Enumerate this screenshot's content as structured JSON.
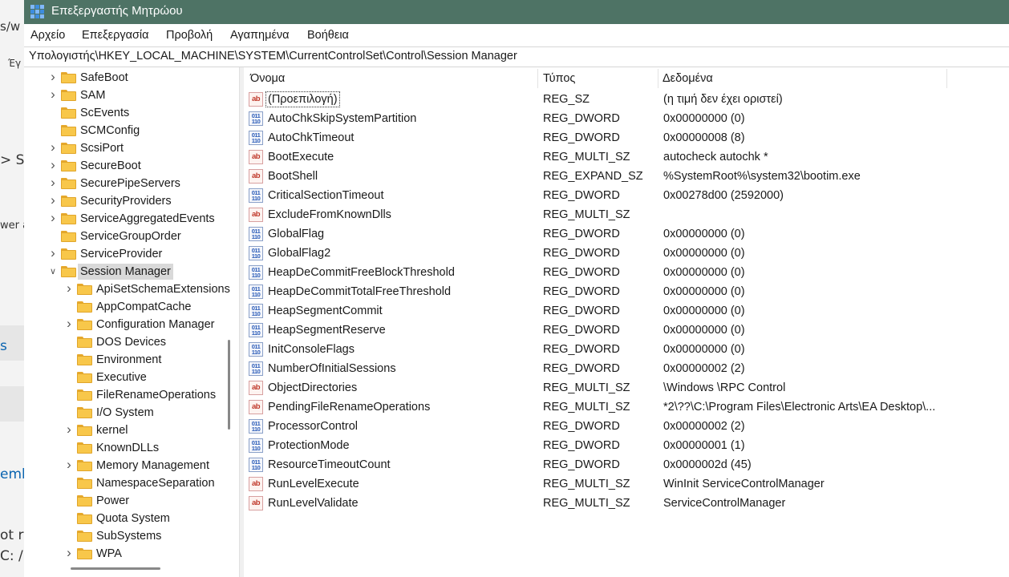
{
  "background_window": {
    "fragments": [
      "s/w",
      "Έγ",
      "> SY",
      "wer a",
      "s",
      "emb",
      "ot r",
      "C: /r"
    ]
  },
  "window": {
    "title": "Επεξεργαστής Μητρώου",
    "title_bar_color": "#4e7365"
  },
  "menu": {
    "items": [
      "Αρχείο",
      "Επεξεργασία",
      "Προβολή",
      "Αγαπημένα",
      "Βοήθεια"
    ]
  },
  "address": {
    "path": "Υπολογιστής\\HKEY_LOCAL_MACHINE\\SYSTEM\\CurrentControlSet\\Control\\Session Manager"
  },
  "tree": {
    "items": [
      {
        "label": "SafeBoot",
        "chevron": "right"
      },
      {
        "label": "SAM",
        "chevron": "right"
      },
      {
        "label": "ScEvents",
        "chevron": "none"
      },
      {
        "label": "SCMConfig",
        "chevron": "none"
      },
      {
        "label": "ScsiPort",
        "chevron": "right"
      },
      {
        "label": "SecureBoot",
        "chevron": "right"
      },
      {
        "label": "SecurePipeServers",
        "chevron": "right"
      },
      {
        "label": "SecurityProviders",
        "chevron": "right"
      },
      {
        "label": "ServiceAggregatedEvents",
        "chevron": "right"
      },
      {
        "label": "ServiceGroupOrder",
        "chevron": "none"
      },
      {
        "label": "ServiceProvider",
        "chevron": "right"
      },
      {
        "label": "Session Manager",
        "chevron": "down",
        "selected": true
      },
      {
        "label": "ApiSetSchemaExtensions",
        "chevron": "right",
        "child": true
      },
      {
        "label": "AppCompatCache",
        "chevron": "none",
        "child": true
      },
      {
        "label": "Configuration Manager",
        "chevron": "right",
        "child": true
      },
      {
        "label": "DOS Devices",
        "chevron": "none",
        "child": true
      },
      {
        "label": "Environment",
        "chevron": "none",
        "child": true
      },
      {
        "label": "Executive",
        "chevron": "none",
        "child": true
      },
      {
        "label": "FileRenameOperations",
        "chevron": "none",
        "child": true
      },
      {
        "label": "I/O System",
        "chevron": "none",
        "child": true
      },
      {
        "label": "kernel",
        "chevron": "right",
        "child": true
      },
      {
        "label": "KnownDLLs",
        "chevron": "none",
        "child": true
      },
      {
        "label": "Memory Management",
        "chevron": "right",
        "child": true
      },
      {
        "label": "NamespaceSeparation",
        "chevron": "none",
        "child": true
      },
      {
        "label": "Power",
        "chevron": "none",
        "child": true
      },
      {
        "label": "Quota System",
        "chevron": "none",
        "child": true
      },
      {
        "label": "SubSystems",
        "chevron": "none",
        "child": true
      },
      {
        "label": "WPA",
        "chevron": "right",
        "child": true
      }
    ]
  },
  "list": {
    "columns": [
      "Όνομα",
      "Τύπος",
      "Δεδομένα"
    ],
    "rows": [
      {
        "name": "(Προεπιλογή)",
        "type": "REG_SZ",
        "data": "(η τιμή δεν έχει οριστεί)",
        "icon": "string-value-icon"
      },
      {
        "name": "AutoChkSkipSystemPartition",
        "type": "REG_DWORD",
        "data": "0x00000000 (0)",
        "icon": "binary-value-icon"
      },
      {
        "name": "AutoChkTimeout",
        "type": "REG_DWORD",
        "data": "0x00000008 (8)",
        "icon": "binary-value-icon"
      },
      {
        "name": "BootExecute",
        "type": "REG_MULTI_SZ",
        "data": "autocheck autochk *",
        "icon": "string-value-icon"
      },
      {
        "name": "BootShell",
        "type": "REG_EXPAND_SZ",
        "data": "%SystemRoot%\\system32\\bootim.exe",
        "icon": "string-value-icon"
      },
      {
        "name": "CriticalSectionTimeout",
        "type": "REG_DWORD",
        "data": "0x00278d00 (2592000)",
        "icon": "binary-value-icon"
      },
      {
        "name": "ExcludeFromKnownDlls",
        "type": "REG_MULTI_SZ",
        "data": "",
        "icon": "string-value-icon"
      },
      {
        "name": "GlobalFlag",
        "type": "REG_DWORD",
        "data": "0x00000000 (0)",
        "icon": "binary-value-icon"
      },
      {
        "name": "GlobalFlag2",
        "type": "REG_DWORD",
        "data": "0x00000000 (0)",
        "icon": "binary-value-icon"
      },
      {
        "name": "HeapDeCommitFreeBlockThreshold",
        "type": "REG_DWORD",
        "data": "0x00000000 (0)",
        "icon": "binary-value-icon"
      },
      {
        "name": "HeapDeCommitTotalFreeThreshold",
        "type": "REG_DWORD",
        "data": "0x00000000 (0)",
        "icon": "binary-value-icon"
      },
      {
        "name": "HeapSegmentCommit",
        "type": "REG_DWORD",
        "data": "0x00000000 (0)",
        "icon": "binary-value-icon"
      },
      {
        "name": "HeapSegmentReserve",
        "type": "REG_DWORD",
        "data": "0x00000000 (0)",
        "icon": "binary-value-icon"
      },
      {
        "name": "InitConsoleFlags",
        "type": "REG_DWORD",
        "data": "0x00000000 (0)",
        "icon": "binary-value-icon"
      },
      {
        "name": "NumberOfInitialSessions",
        "type": "REG_DWORD",
        "data": "0x00000002 (2)",
        "icon": "binary-value-icon"
      },
      {
        "name": "ObjectDirectories",
        "type": "REG_MULTI_SZ",
        "data": "\\Windows \\RPC Control",
        "icon": "string-value-icon"
      },
      {
        "name": "PendingFileRenameOperations",
        "type": "REG_MULTI_SZ",
        "data": "*2\\??\\C:\\Program Files\\Electronic Arts\\EA Desktop\\...",
        "icon": "string-value-icon"
      },
      {
        "name": "ProcessorControl",
        "type": "REG_DWORD",
        "data": "0x00000002 (2)",
        "icon": "binary-value-icon"
      },
      {
        "name": "ProtectionMode",
        "type": "REG_DWORD",
        "data": "0x00000001 (1)",
        "icon": "binary-value-icon"
      },
      {
        "name": "ResourceTimeoutCount",
        "type": "REG_DWORD",
        "data": "0x0000002d (45)",
        "icon": "binary-value-icon"
      },
      {
        "name": "RunLevelExecute",
        "type": "REG_MULTI_SZ",
        "data": "WinInit ServiceControlManager",
        "icon": "string-value-icon"
      },
      {
        "name": "RunLevelValidate",
        "type": "REG_MULTI_SZ",
        "data": "ServiceControlManager",
        "icon": "string-value-icon"
      }
    ]
  }
}
